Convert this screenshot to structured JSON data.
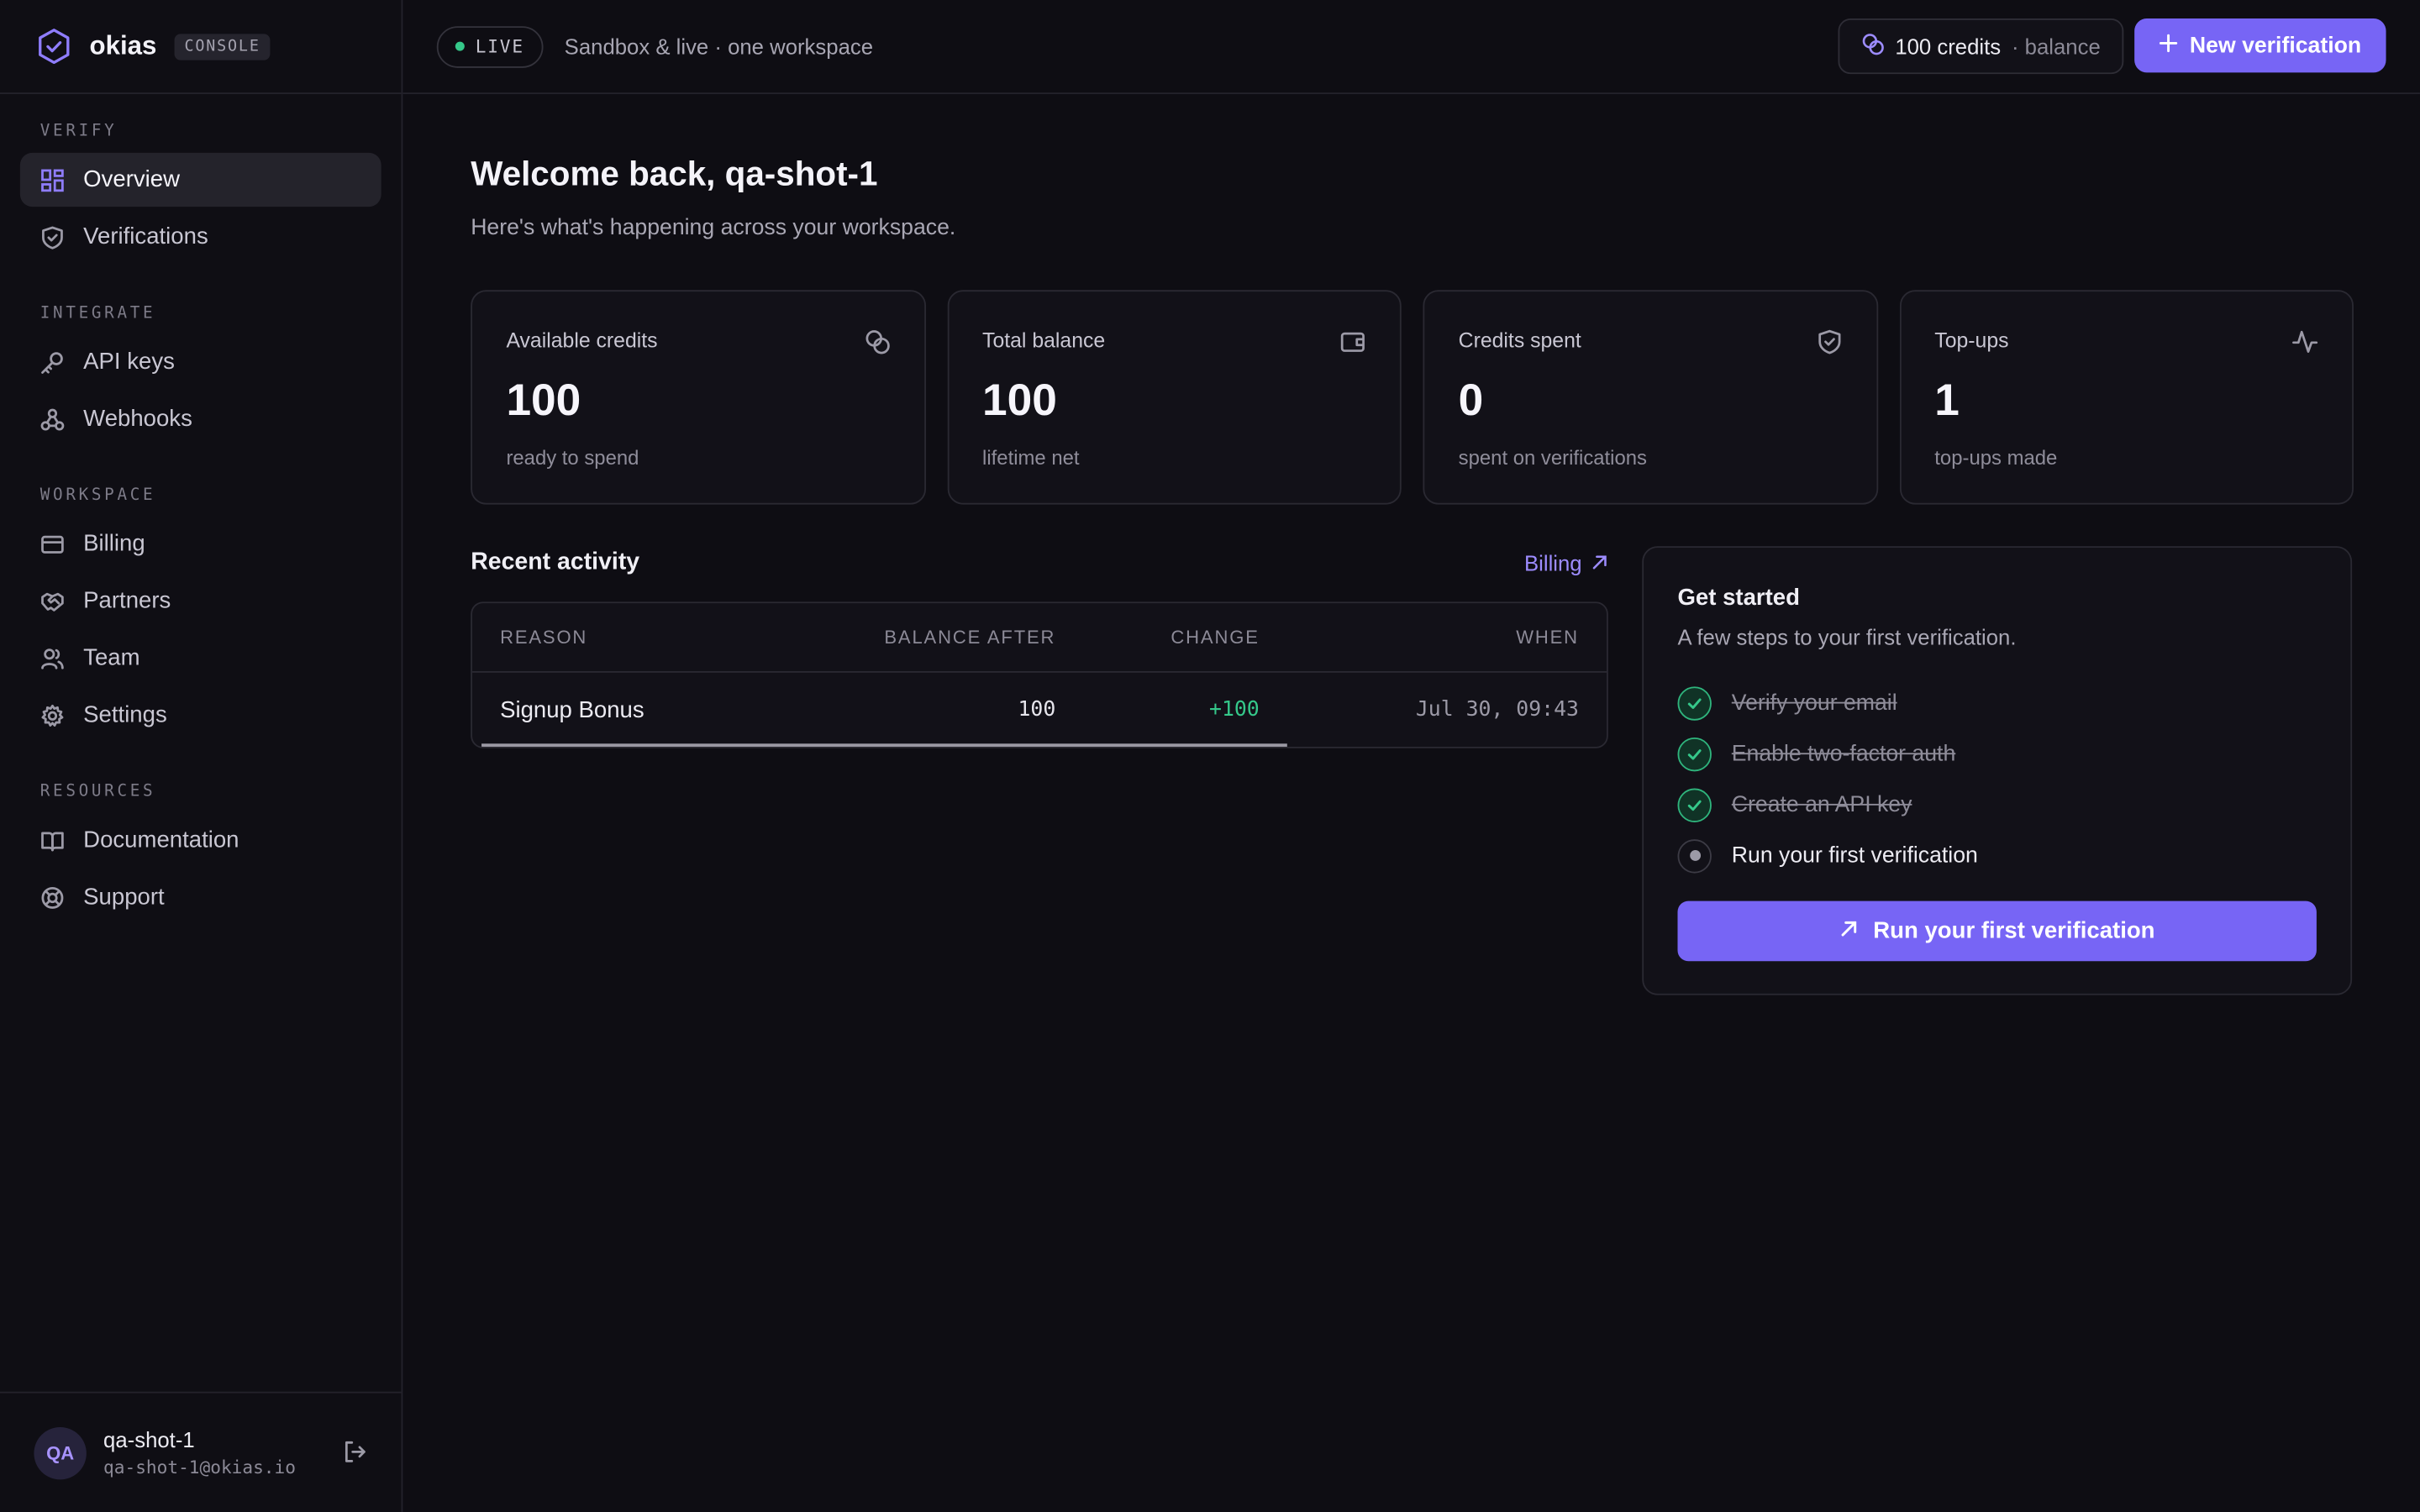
{
  "brand": {
    "name": "okias",
    "tag": "CONSOLE"
  },
  "sidebar": {
    "sections": [
      {
        "title": "VERIFY",
        "items": [
          {
            "label": "Overview",
            "icon": "grid-icon",
            "active": true
          },
          {
            "label": "Verifications",
            "icon": "shield-check-icon",
            "active": false
          }
        ]
      },
      {
        "title": "INTEGRATE",
        "items": [
          {
            "label": "API keys",
            "icon": "key-icon",
            "active": false
          },
          {
            "label": "Webhooks",
            "icon": "webhook-icon",
            "active": false
          }
        ]
      },
      {
        "title": "WORKSPACE",
        "items": [
          {
            "label": "Billing",
            "icon": "card-icon",
            "active": false
          },
          {
            "label": "Partners",
            "icon": "handshake-icon",
            "active": false
          },
          {
            "label": "Team",
            "icon": "users-icon",
            "active": false
          },
          {
            "label": "Settings",
            "icon": "gear-icon",
            "active": false
          }
        ]
      },
      {
        "title": "RESOURCES",
        "items": [
          {
            "label": "Documentation",
            "icon": "book-icon",
            "active": false
          },
          {
            "label": "Support",
            "icon": "lifebuoy-icon",
            "active": false
          }
        ]
      }
    ]
  },
  "user": {
    "initials": "QA",
    "name": "qa-shot-1",
    "email": "qa-shot-1@okias.io"
  },
  "topbar": {
    "live_label": "LIVE",
    "subtitle": "Sandbox & live · one workspace",
    "credits_value": "100 credits",
    "credits_suffix": "· balance",
    "new_button": "New verification"
  },
  "main": {
    "title": "Welcome back, qa-shot-1",
    "lead": "Here's what's happening across your workspace."
  },
  "stats": [
    {
      "label": "Available credits",
      "value": "100",
      "hint": "ready to spend",
      "icon": "coins-icon"
    },
    {
      "label": "Total balance",
      "value": "100",
      "hint": "lifetime net",
      "icon": "wallet-icon"
    },
    {
      "label": "Credits spent",
      "value": "0",
      "hint": "spent on verifications",
      "icon": "shield-check-icon"
    },
    {
      "label": "Top-ups",
      "value": "1",
      "hint": "top-ups made",
      "icon": "activity-icon"
    }
  ],
  "activity": {
    "title": "Recent activity",
    "link": "Billing",
    "columns": [
      "REASON",
      "BALANCE AFTER",
      "CHANGE",
      "WHEN"
    ],
    "rows": [
      {
        "reason": "Signup Bonus",
        "balance_after": "100",
        "change": "+100",
        "when": "Jul 30, 09:43"
      }
    ]
  },
  "started": {
    "title": "Get started",
    "subtitle": "A few steps to your first verification.",
    "steps": [
      {
        "label": "Verify your email",
        "done": true
      },
      {
        "label": "Enable two-factor auth",
        "done": true
      },
      {
        "label": "Create an API key",
        "done": true
      },
      {
        "label": "Run your first verification",
        "done": false
      }
    ],
    "button": "Run your first verification"
  },
  "colors": {
    "accent": "#7765f5",
    "success": "#35c88a",
    "background": "#0e0d13"
  }
}
